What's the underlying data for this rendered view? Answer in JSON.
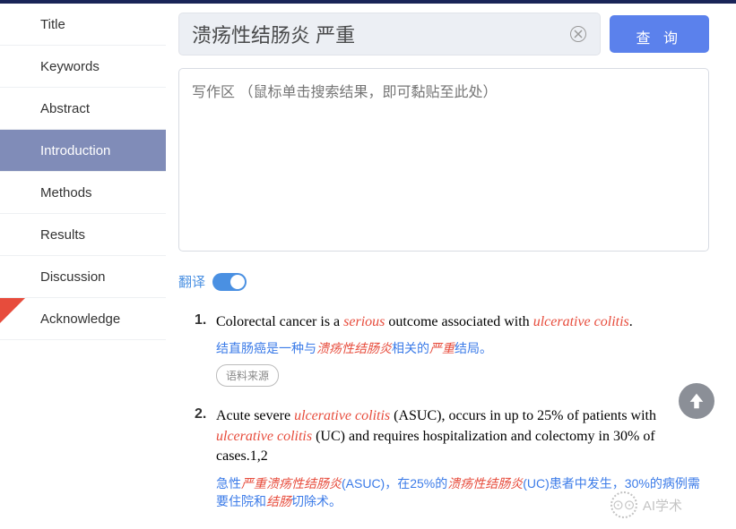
{
  "sidebar": {
    "items": [
      {
        "label": "Title"
      },
      {
        "label": "Keywords"
      },
      {
        "label": "Abstract"
      },
      {
        "label": "Introduction",
        "active": true
      },
      {
        "label": "Methods"
      },
      {
        "label": "Results"
      },
      {
        "label": "Discussion"
      },
      {
        "label": "Acknowledge",
        "new": true
      }
    ]
  },
  "search": {
    "value": "溃疡性结肠炎 严重",
    "button": "查 询"
  },
  "writingArea": {
    "placeholder": "写作区 （鼠标单击搜索结果，即可黏贴至此处）"
  },
  "translate": {
    "label": "翻译",
    "on": true
  },
  "results": [
    {
      "idx": "1.",
      "en_pre": "Colorectal cancer is a ",
      "en_hl1": "serious",
      "en_mid": " outcome associated with ",
      "en_hl2": "ulcerative colitis",
      "en_post": ".",
      "cn_p1": "结直肠癌是一种与",
      "cn_h1": "溃疡性结肠炎",
      "cn_p2": "相关的",
      "cn_h2": "严重",
      "cn_p3": "结局。",
      "source": "语料来源"
    },
    {
      "idx": "2.",
      "en_pre": "Acute severe ",
      "en_hl1": "ulcerative colitis",
      "en_mid": " (ASUC), occurs in up to 25% of patients with ",
      "en_hl2": "ulcerative colitis",
      "en_post": " (UC) and requires hospitalization and colectomy in 30% of cases.1,2",
      "cn_p1": "急性",
      "cn_h1": "严重溃疡性结肠炎",
      "cn_p2": "(ASUC)，在25%的",
      "cn_h2": "溃疡性结肠炎",
      "cn_p3": "(UC)患者中发生，30%的病例需要住院和",
      "cn_h3": "结肠",
      "cn_p4": "切除术。"
    }
  ],
  "watermark": "AI学术"
}
